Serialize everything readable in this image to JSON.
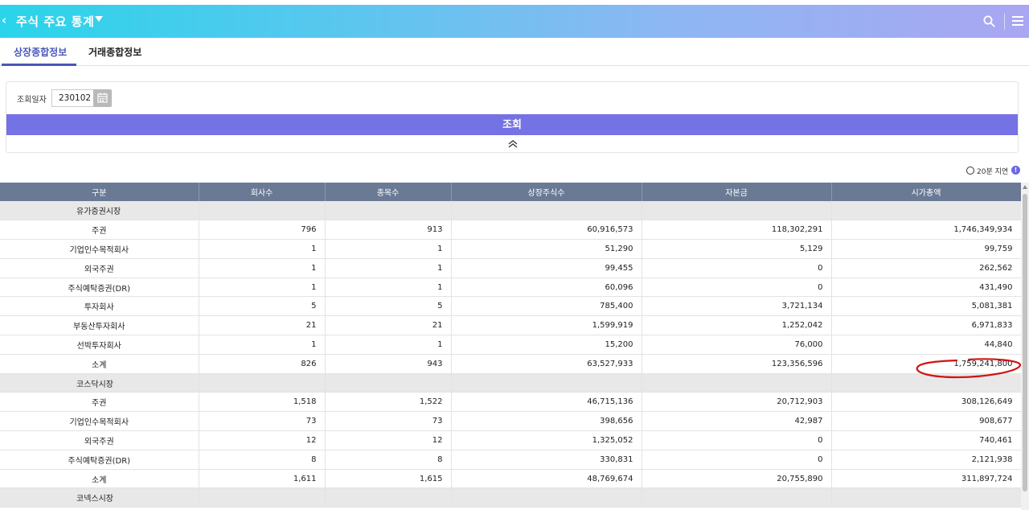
{
  "header": {
    "back_icon": "chevron-left-icon",
    "title": "주식  주요 통계",
    "caret_icon": "caret-down-icon",
    "search_icon": "search-icon",
    "menu_icon": "hamburger-menu-icon"
  },
  "tabs": [
    {
      "label": "상장종합정보",
      "active": true
    },
    {
      "label": "거래종합정보",
      "active": false
    }
  ],
  "search": {
    "date_label": "조회일자",
    "date_value": "230102",
    "calendar_icon": "calendar-icon",
    "button_label": "조회",
    "collapse_icon": "double-chevron-up-icon"
  },
  "delay_notice": "20분 지연",
  "table": {
    "headers": [
      "구분",
      "회사수",
      "종목수",
      "상장주식수",
      "자본금",
      "시가총액"
    ],
    "rows": [
      {
        "type": "group",
        "cells": [
          "유가증권시장",
          "",
          "",
          "",
          "",
          ""
        ]
      },
      {
        "type": "row",
        "cells": [
          "주권",
          "796",
          "913",
          "60,916,573",
          "118,302,291",
          "1,746,349,934"
        ]
      },
      {
        "type": "row",
        "cells": [
          "기업인수목적회사",
          "1",
          "1",
          "51,290",
          "5,129",
          "99,759"
        ]
      },
      {
        "type": "row",
        "cells": [
          "외국주권",
          "1",
          "1",
          "99,455",
          "0",
          "262,562"
        ]
      },
      {
        "type": "row",
        "cells": [
          "주식예탁증권(DR)",
          "1",
          "1",
          "60,096",
          "0",
          "431,490"
        ]
      },
      {
        "type": "row",
        "cells": [
          "투자회사",
          "5",
          "5",
          "785,400",
          "3,721,134",
          "5,081,381"
        ]
      },
      {
        "type": "row",
        "cells": [
          "부동산투자회사",
          "21",
          "21",
          "1,599,919",
          "1,252,042",
          "6,971,833"
        ]
      },
      {
        "type": "row",
        "cells": [
          "선박투자회사",
          "1",
          "1",
          "15,200",
          "76,000",
          "44,840"
        ]
      },
      {
        "type": "row",
        "cells": [
          "소계",
          "826",
          "943",
          "63,527,933",
          "123,356,596",
          "1,759,241,800"
        ]
      },
      {
        "type": "group",
        "cells": [
          "코스닥시장",
          "",
          "",
          "",
          "",
          ""
        ]
      },
      {
        "type": "row",
        "cells": [
          "주권",
          "1,518",
          "1,522",
          "46,715,136",
          "20,712,903",
          "308,126,649"
        ]
      },
      {
        "type": "row",
        "cells": [
          "기업인수목적회사",
          "73",
          "73",
          "398,656",
          "42,987",
          "908,677"
        ]
      },
      {
        "type": "row",
        "cells": [
          "외국주권",
          "12",
          "12",
          "1,325,052",
          "0",
          "740,461"
        ]
      },
      {
        "type": "row",
        "cells": [
          "주식예탁증권(DR)",
          "8",
          "8",
          "330,831",
          "0",
          "2,121,938"
        ]
      },
      {
        "type": "row",
        "cells": [
          "소계",
          "1,611",
          "1,615",
          "48,769,674",
          "20,755,890",
          "311,897,724"
        ]
      },
      {
        "type": "group",
        "cells": [
          "코넥스시장",
          "",
          "",
          "",
          "",
          ""
        ]
      }
    ]
  },
  "colors": {
    "accent": "#7472e4",
    "tab_active": "#4a56b8",
    "table_header": "#6a7a95",
    "annotation": "#d01414"
  }
}
